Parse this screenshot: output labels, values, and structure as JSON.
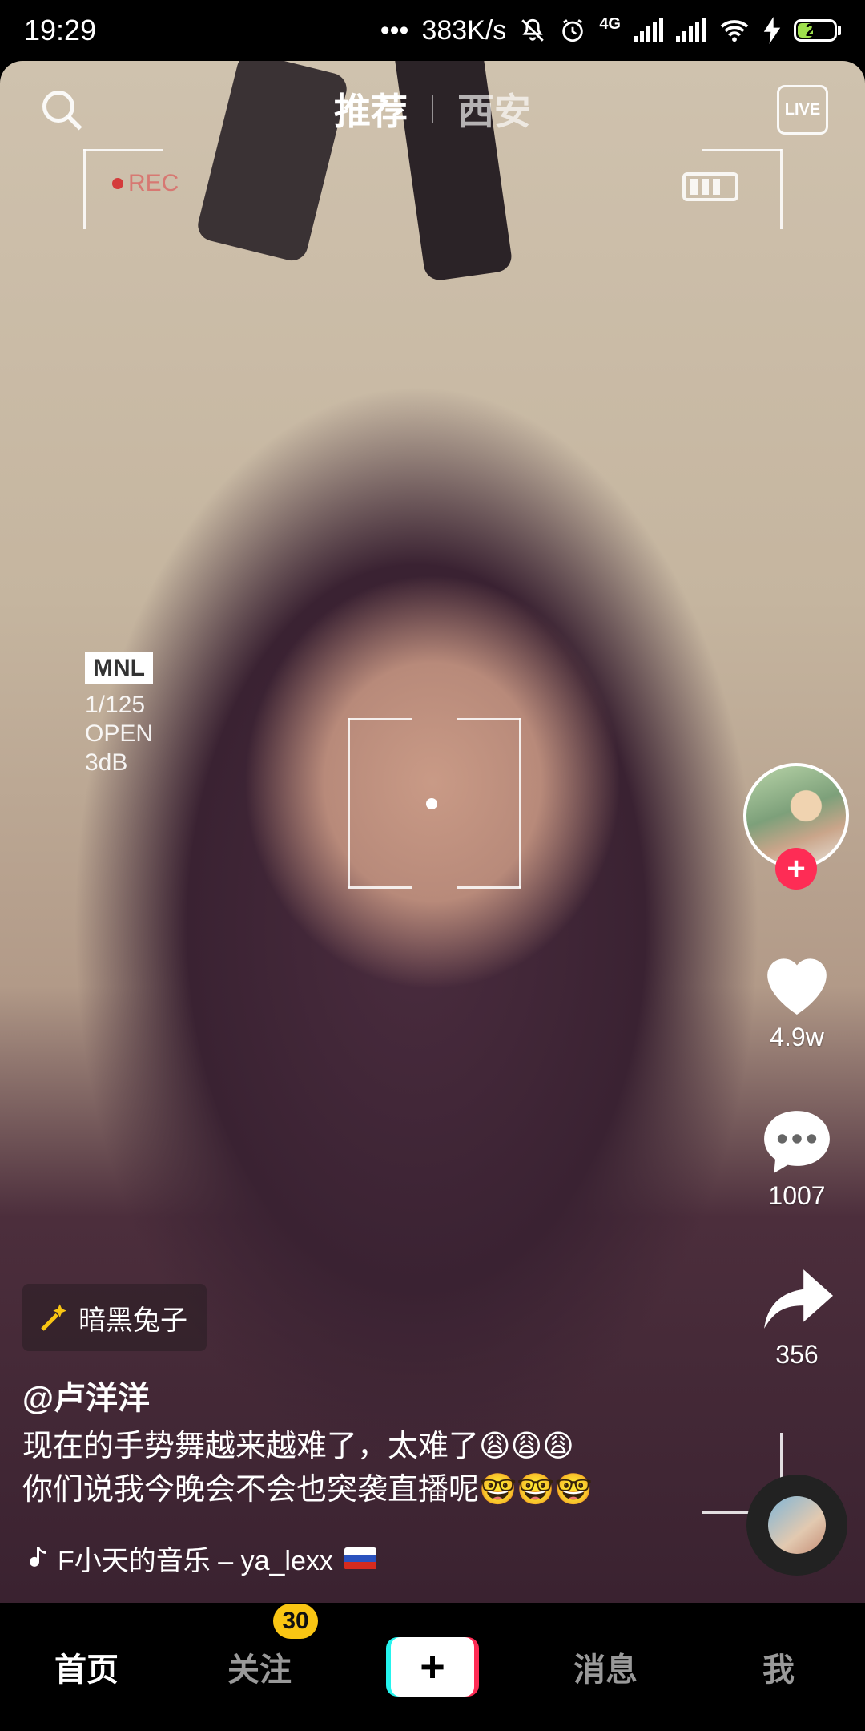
{
  "status_bar": {
    "time": "19:29",
    "network_speed": "383K/s",
    "network_type": "4G",
    "battery_level": "24",
    "icons": [
      "mute-icon",
      "alarm-icon",
      "signal-icon",
      "signal-icon-2",
      "wifi-icon",
      "charging-icon",
      "battery-icon"
    ]
  },
  "top_bar": {
    "tabs": [
      {
        "label": "推荐",
        "active": true
      },
      {
        "label": "西安",
        "active": false
      }
    ],
    "search_icon": "search-icon",
    "live_label": "LIVE"
  },
  "video_overlay": {
    "rec_label": "REC",
    "mnl": "MNL",
    "shutter": "1/125",
    "aperture": "OPEN",
    "gain": "3dB"
  },
  "actions": {
    "likes": "4.9w",
    "comments": "1007",
    "shares": "356",
    "follow_symbol": "+"
  },
  "post": {
    "effect_tag": "暗黑兔子",
    "username": "@卢洋洋",
    "caption_line1": "现在的手势舞越来越难了，太难了😩😩😩",
    "caption_line2": "你们说我今晚会不会也突袭直播呢🤓🤓🤓",
    "music": "F小天的音乐 – ya_lexx"
  },
  "bottom_nav": {
    "items": [
      "首页",
      "关注",
      "消息",
      "我"
    ],
    "follow_badge": "30",
    "add_symbol": "+"
  },
  "colors": {
    "accent_red": "#fe2c55",
    "accent_cyan": "#25f4ee",
    "badge_yellow": "#f9c513"
  }
}
